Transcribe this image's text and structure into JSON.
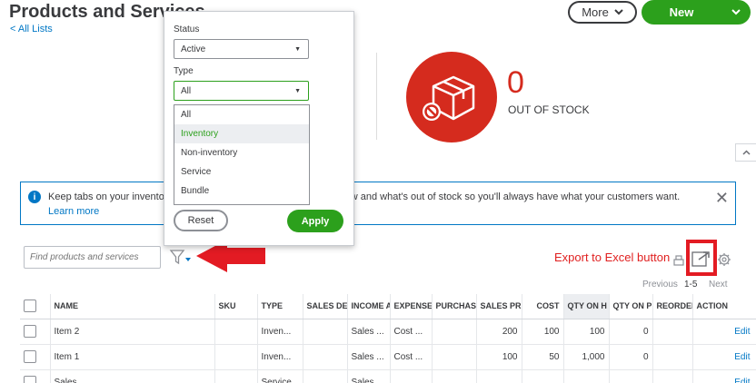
{
  "header": {
    "title": "Products and Services",
    "back_link": "< All Lists",
    "more_label": "More",
    "new_label": "New"
  },
  "stock": {
    "count": "0",
    "label": "OUT OF STOCK",
    "icon": "package-blocked-icon",
    "color": "#d52b1e"
  },
  "banner": {
    "message_start": "Keep tabs on your inventory",
    "message_end": "g low and what's out of stock so you'll always have what your customers want.",
    "link": "Learn more",
    "icon": "info-icon"
  },
  "toolbar": {
    "search_placeholder": "Find products and services",
    "export_annotation": "Export to Excel button"
  },
  "pager": {
    "previous": "Previous",
    "range": "1-5",
    "next": "Next"
  },
  "filter_popup": {
    "status_label": "Status",
    "status_value": "Active",
    "type_label": "Type",
    "type_value": "All",
    "type_options": [
      "All",
      "Inventory",
      "Non-inventory",
      "Service",
      "Bundle"
    ],
    "highlighted_option": "Inventory",
    "reset_label": "Reset",
    "apply_label": "Apply"
  },
  "table": {
    "columns": [
      "NAME",
      "SKU",
      "TYPE",
      "SALES DE",
      "INCOME A",
      "EXPENSE",
      "PURCHAS",
      "SALES PR",
      "COST",
      "QTY ON H",
      "QTY ON P",
      "REORDER",
      "ACTION"
    ],
    "rows": [
      {
        "name": "Item 2",
        "sku": "",
        "type": "Inven...",
        "sales_desc": "",
        "income": "Sales ...",
        "expense": "Cost ...",
        "purchase": "",
        "sales_price": "200",
        "cost": "100",
        "qty_on_hand": "100",
        "qty_on_po": "0",
        "reorder": "",
        "action": "Edit"
      },
      {
        "name": "Item 1",
        "sku": "",
        "type": "Inven...",
        "sales_desc": "",
        "income": "Sales ...",
        "expense": "Cost ...",
        "purchase": "",
        "sales_price": "100",
        "cost": "50",
        "qty_on_hand": "1,000",
        "qty_on_po": "0",
        "reorder": "",
        "action": "Edit"
      },
      {
        "name": "Sales",
        "sku": "",
        "type": "Service",
        "sales_desc": "",
        "income": "Sales ...",
        "expense": "",
        "purchase": "",
        "sales_price": "",
        "cost": "",
        "qty_on_hand": "",
        "qty_on_po": "",
        "reorder": "",
        "action": "Edit"
      }
    ]
  },
  "colors": {
    "brand_green": "#2ca01c",
    "link_blue": "#0077c5",
    "alert_red": "#e31b23"
  }
}
